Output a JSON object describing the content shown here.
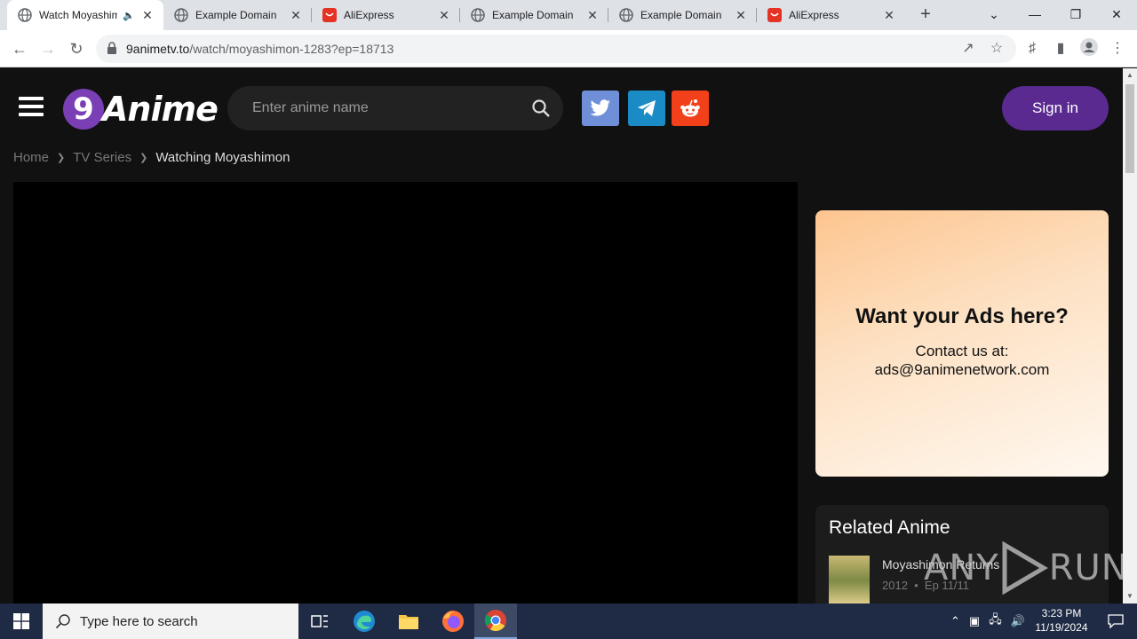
{
  "browser": {
    "tabs": [
      {
        "title": "Watch Moyashimon",
        "icon": "9anime-favicon",
        "active": true,
        "audio": true
      },
      {
        "title": "Example Domain",
        "icon": "globe-icon"
      },
      {
        "title": "AliExpress",
        "icon": "aliexpress-favicon"
      },
      {
        "title": "Example Domain",
        "icon": "globe-icon"
      },
      {
        "title": "Example Domain",
        "icon": "globe-icon"
      },
      {
        "title": "AliExpress",
        "icon": "aliexpress-favicon"
      }
    ],
    "url_host": "9animetv.to",
    "url_path": "/watch/moyashimon-1283?ep=18713"
  },
  "site": {
    "logo_digit": "9",
    "logo_word": "Anime",
    "search_placeholder": "Enter anime name",
    "signin_label": "Sign in",
    "social": [
      "twitter-icon",
      "telegram-icon",
      "reddit-icon"
    ],
    "colors": {
      "accent": "#5a2a91",
      "twitter": "#6f8fd8",
      "telegram": "#1b8bc6",
      "reddit": "#f2411a"
    }
  },
  "breadcrumb": {
    "home": "Home",
    "section": "TV Series",
    "current": "Watching Moyashimon"
  },
  "ad": {
    "title": "Want your Ads here?",
    "line1": "Contact us at:",
    "line2": "ads@9animenetwork.com"
  },
  "related": {
    "heading": "Related Anime",
    "items": [
      {
        "title": "Moyashimon Returns",
        "year": "2012",
        "eps": "Ep 11/11"
      }
    ]
  },
  "watermark": {
    "left": "ANY",
    "right": "RUN"
  },
  "taskbar": {
    "search_placeholder": "Type here to search",
    "time": "3:23 PM",
    "date": "11/19/2024"
  }
}
